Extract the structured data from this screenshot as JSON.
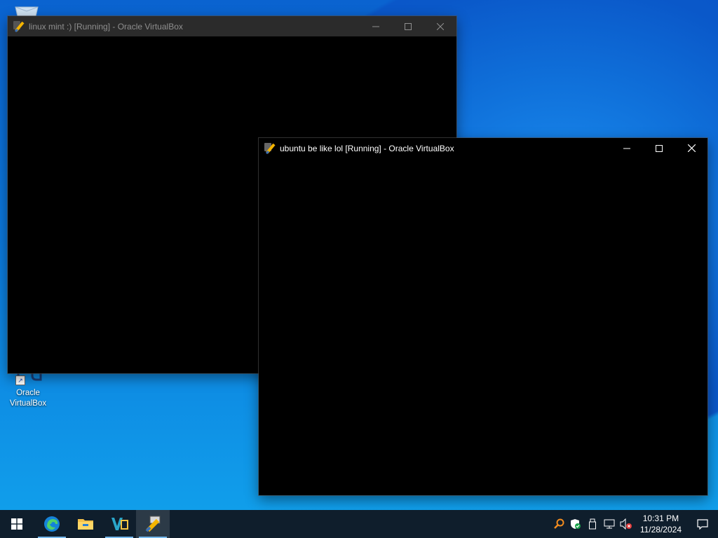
{
  "desktop": {
    "icons": [
      {
        "label": "Recycle Bin"
      },
      {
        "label_line1": "Oracle",
        "label_line2": "VirtualBox"
      }
    ]
  },
  "windows": [
    {
      "title": "linux mint :) [Running] - Oracle VirtualBox",
      "state": "inactive"
    },
    {
      "title": "ubuntu be like lol [Running] - Oracle VirtualBox",
      "state": "active"
    }
  ],
  "window_controls": {
    "minimize": "minimize",
    "maximize": "maximize",
    "close": "close"
  },
  "taskbar": {
    "start": "start-button",
    "apps": [
      "Microsoft Edge",
      "File Explorer",
      "VirtualBox Manager",
      "VirtualBox VM"
    ],
    "tray": {
      "time": "10:31 PM",
      "date": "11/28/2024"
    }
  },
  "colors": {
    "taskbar_bg": "#0f1e2c",
    "accent": "#76b9ed",
    "inactive_title_bg": "#2b2b2b",
    "active_title_bg": "#000000"
  }
}
